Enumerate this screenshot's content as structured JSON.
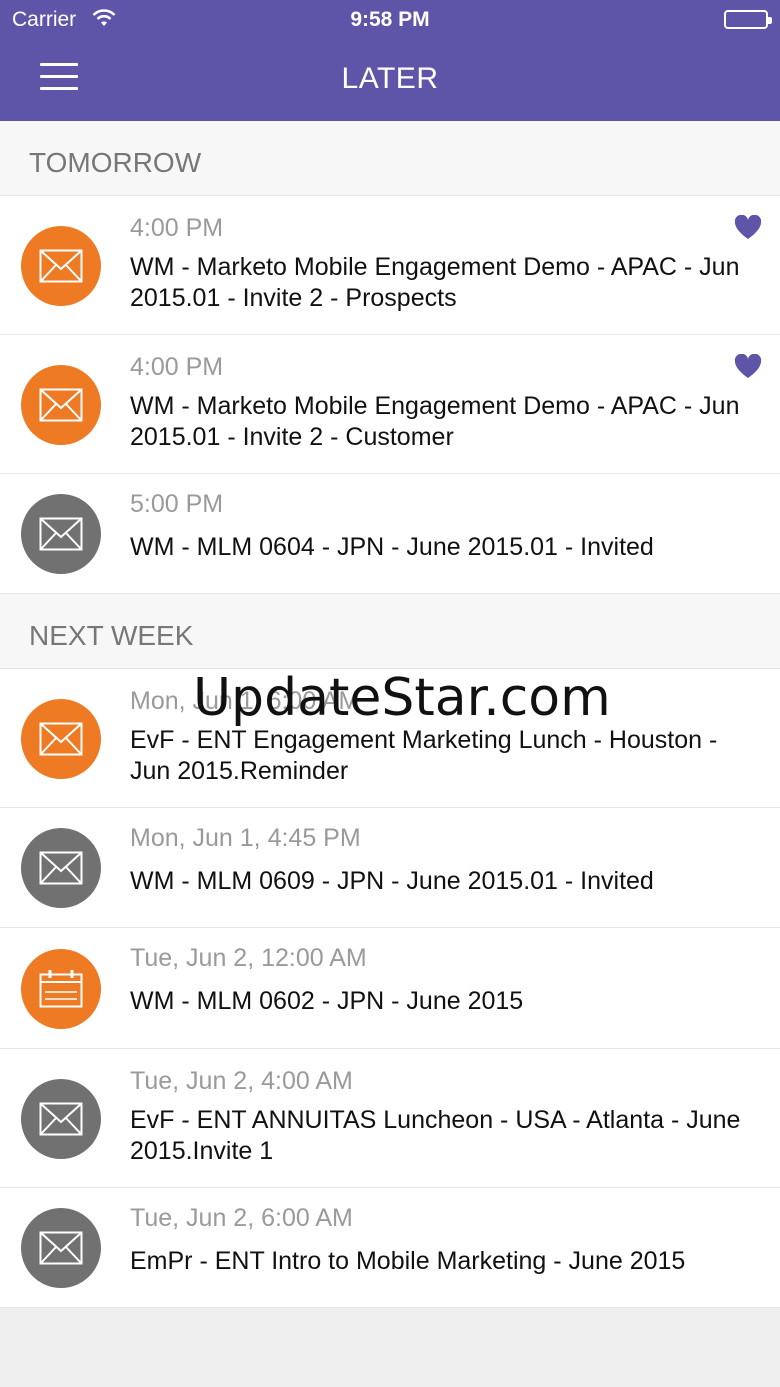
{
  "status_bar": {
    "carrier": "Carrier",
    "time": "9:58 PM"
  },
  "nav": {
    "title": "LATER",
    "menu_icon": "hamburger-menu-icon"
  },
  "colors": {
    "nav_bg": "#5e55a8",
    "orange": "#ee7a23",
    "gray": "#717171",
    "heart": "#5e55a8"
  },
  "sections": [
    {
      "header": "TOMORROW",
      "items": [
        {
          "time": "4:00 PM",
          "text": "WM - Marketo Mobile Engagement Demo - APAC - Jun 2015.01 - Invite 2 - Prospects",
          "icon": "envelope-icon",
          "color": "orange",
          "favorite": true
        },
        {
          "time": "4:00 PM",
          "text": "WM - Marketo Mobile Engagement Demo - APAC - Jun 2015.01 - Invite 2 - Customer",
          "icon": "envelope-icon",
          "color": "orange",
          "favorite": true
        },
        {
          "time": "5:00 PM",
          "text": "WM - MLM 0604 - JPN - June 2015.01 - Invited",
          "icon": "envelope-icon",
          "color": "gray",
          "favorite": false
        }
      ]
    },
    {
      "header": "NEXT WEEK",
      "items": [
        {
          "time": "Mon, Jun 1, 6:00 AM",
          "text": "EvF - ENT Engagement Marketing Lunch - Houston - Jun 2015.Reminder",
          "icon": "envelope-icon",
          "color": "orange",
          "favorite": false
        },
        {
          "time": "Mon, Jun 1, 4:45 PM",
          "text": "WM - MLM 0609 - JPN - June 2015.01 - Invited",
          "icon": "envelope-icon",
          "color": "gray",
          "favorite": false
        },
        {
          "time": "Tue, Jun 2, 12:00 AM",
          "text": "WM - MLM 0602 - JPN - June 2015",
          "icon": "calendar-icon",
          "color": "orange",
          "favorite": false
        },
        {
          "time": "Tue, Jun 2, 4:00 AM",
          "text": "EvF - ENT ANNUITAS Luncheon - USA - Atlanta - June 2015.Invite 1",
          "icon": "envelope-icon",
          "color": "gray",
          "favorite": false
        },
        {
          "time": "Tue, Jun 2, 6:00 AM",
          "text": "EmPr - ENT Intro to Mobile Marketing - June 2015",
          "icon": "envelope-icon",
          "color": "gray",
          "favorite": false
        }
      ]
    }
  ],
  "watermark": "UpdateStar.com"
}
